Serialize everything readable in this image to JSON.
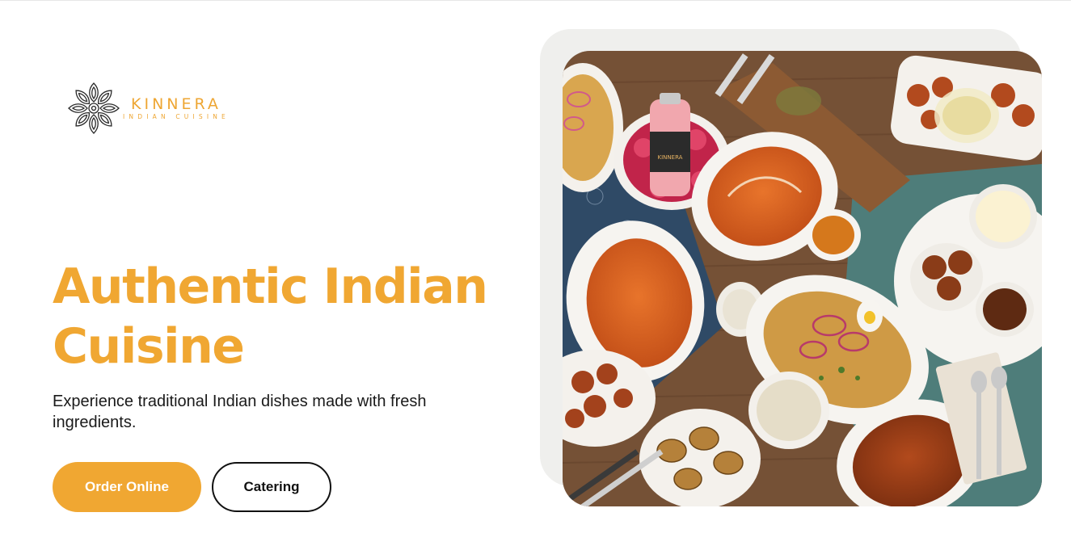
{
  "brand": {
    "name": "KINNERA",
    "tagline": "INDIAN CUISINE",
    "accent_color": "#f0a732",
    "logo_icon": "mandala-icon"
  },
  "hero": {
    "title_line1": "Authentic Indian",
    "title_line2": "Cuisine",
    "subtitle": "Experience traditional Indian dishes made with fresh ingredients.",
    "primary_button": "Order Online",
    "secondary_button": "Catering"
  },
  "image": {
    "subject": "food-spread-photo",
    "bottle_label": "KINNERA"
  }
}
